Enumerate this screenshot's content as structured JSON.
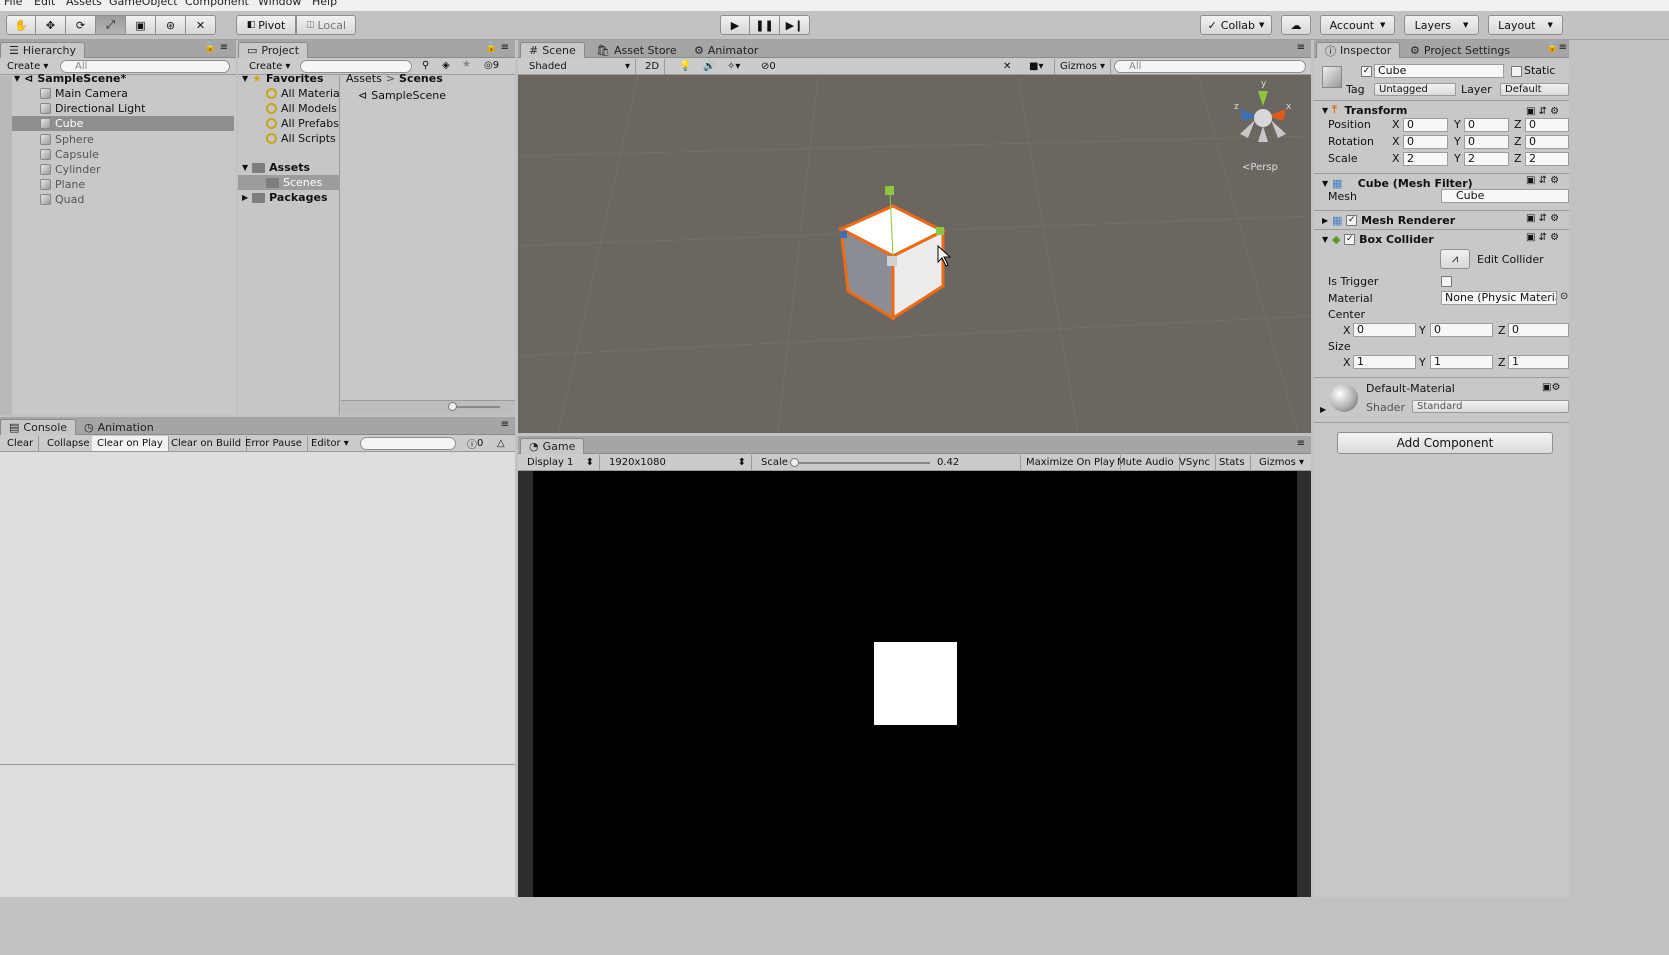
{
  "menu": [
    "File",
    "Edit",
    "Assets",
    "GameObject",
    "Component",
    "Window",
    "Help"
  ],
  "toolbar": {
    "pivot": "Pivot",
    "local": "Local",
    "collab": "Collab",
    "account": "Account",
    "layers": "Layers",
    "layout": "Layout"
  },
  "hierarchy": {
    "tab": "Hierarchy",
    "create": "Create",
    "search_placeholder": "All",
    "scene": "SampleScene*",
    "items": [
      "Main Camera",
      "Directional Light",
      "Cube",
      "Sphere",
      "Capsule",
      "Cylinder",
      "Plane",
      "Quad"
    ]
  },
  "project": {
    "tab": "Project",
    "create": "Create",
    "hidden_count": "9",
    "favorites": "Favorites",
    "favorite_items": [
      "All Materia",
      "All Models",
      "All Prefabs",
      "All Scripts"
    ],
    "assets": "Assets",
    "scenes": "Scenes",
    "packages": "Packages",
    "breadcrumb_root": "Assets",
    "breadcrumb_sep": ">",
    "breadcrumb_leaf": "Scenes",
    "file": "SampleScene"
  },
  "console": {
    "tab": "Console",
    "animation_tab": "Animation",
    "buttons": [
      "Clear",
      "Collapse",
      "Clear on Play",
      "Clear on Build",
      "Error Pause",
      "Editor"
    ],
    "count": "0"
  },
  "scene": {
    "tab": "Scene",
    "asset_store_tab": "Asset Store",
    "animator_tab": "Animator",
    "shading": "Shaded",
    "mode_2d": "2D",
    "hidden": "0",
    "gizmos": "Gizmos",
    "search_placeholder": "All",
    "persp": "Persp",
    "axis_y": "y",
    "axis_x": "x",
    "axis_z": "z"
  },
  "game": {
    "tab": "Game",
    "display": "Display 1",
    "resolution": "1920x1080",
    "scale_label": "Scale",
    "scale_value": "0.42",
    "scale_fraction": 0.0,
    "buttons": [
      "Maximize On Play",
      "Mute Audio",
      "VSync",
      "Stats",
      "Gizmos"
    ]
  },
  "inspector": {
    "tab": "Inspector",
    "settings_tab": "Project Settings",
    "object_name": "Cube",
    "static": "Static",
    "tag_label": "Tag",
    "tag": "Untagged",
    "layer_label": "Layer",
    "layer": "Default",
    "transform": {
      "title": "Transform",
      "position_label": "Position",
      "rotation_label": "Rotation",
      "scale_label": "Scale",
      "position": [
        "0",
        "0",
        "0"
      ],
      "rotation": [
        "0",
        "0",
        "0"
      ],
      "scale": [
        "2",
        "2",
        "2"
      ]
    },
    "mesh_filter": {
      "title": "Cube (Mesh Filter)",
      "mesh_label": "Mesh",
      "mesh": "Cube"
    },
    "mesh_renderer": "Mesh Renderer",
    "box_collider": {
      "title": "Box Collider",
      "edit": "Edit Collider",
      "trigger_label": "Is Trigger",
      "material_label": "Material",
      "material": "None (Physic Materia",
      "center_label": "Center",
      "size_label": "Size",
      "center": [
        "0",
        "0",
        "0"
      ],
      "size": [
        "1",
        "1",
        "1"
      ]
    },
    "material": {
      "name": "Default-Material",
      "shader_label": "Shader",
      "shader": "Standard"
    },
    "add_component": "Add Component"
  }
}
